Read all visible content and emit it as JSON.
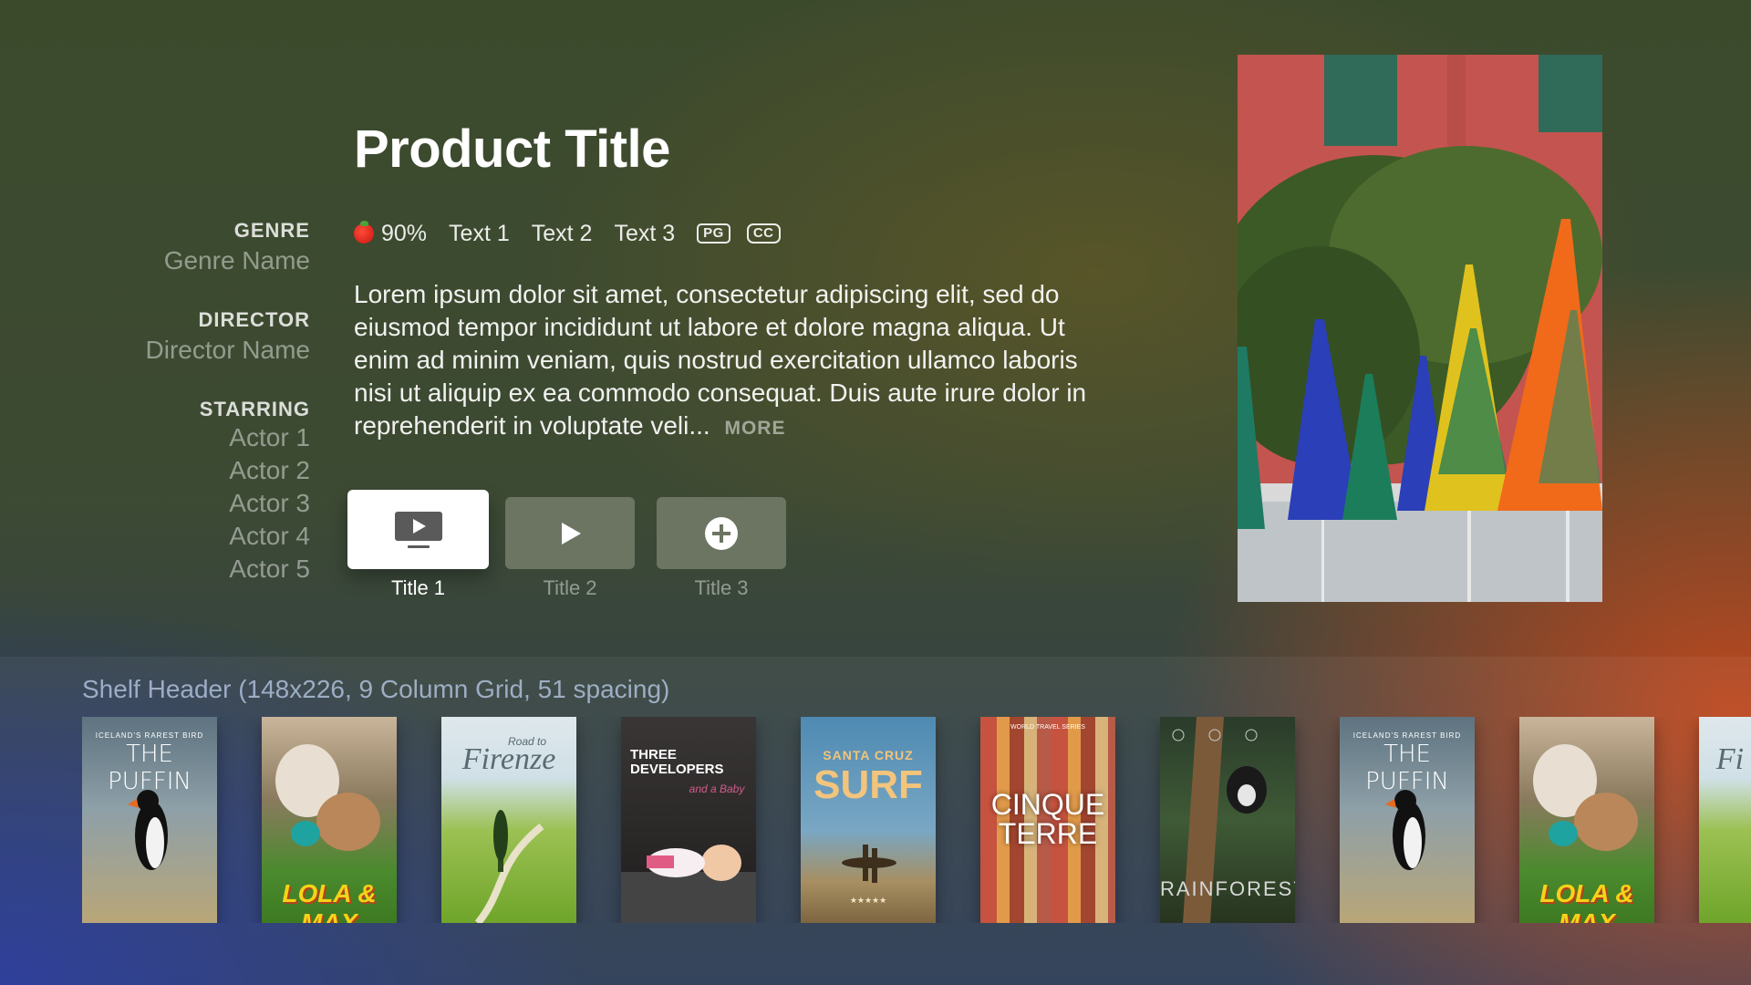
{
  "product": {
    "title": "Product Title",
    "rating_percent": "90%",
    "info_texts": [
      "Text 1",
      "Text 2",
      "Text 3"
    ],
    "badges": [
      "PG",
      "CC"
    ],
    "description": "Lorem ipsum dolor sit amet, consectetur adipiscing elit, sed do eiusmod tempor incididunt ut labore et dolore magna aliqua. Ut enim ad minim veniam, quis nostrud exercitation ullamco laboris nisi ut aliquip ex ea commodo consequat. Duis aute irure dolor in reprehenderit in voluptate veli...",
    "more_label": "MORE"
  },
  "metadata": {
    "genre_label": "GENRE",
    "genre_value": "Genre Name",
    "director_label": "DIRECTOR",
    "director_value": "Director Name",
    "starring_label": "STARRING",
    "actors": [
      "Actor 1",
      "Actor 2",
      "Actor 3",
      "Actor 4",
      "Actor 5"
    ]
  },
  "actions": [
    {
      "label": "Title 1",
      "icon": "tv-play-icon",
      "focused": true
    },
    {
      "label": "Title 2",
      "icon": "play-icon",
      "focused": false
    },
    {
      "label": "Title 3",
      "icon": "plus-circle-icon",
      "focused": false
    }
  ],
  "shelf": {
    "header": "Shelf Header (148x226, 9 Column Grid, 51 spacing)",
    "posters": [
      {
        "name": "puffin",
        "line1": "ICELAND'S RAREST BIRD",
        "line2": "THE PUFFIN"
      },
      {
        "name": "lola-max",
        "line1": "LOLA & MAX"
      },
      {
        "name": "firenze",
        "line1": "Road to",
        "line2": "Firenze"
      },
      {
        "name": "three-developers",
        "line1": "THREE DEVELOPERS",
        "line2": "and a Baby"
      },
      {
        "name": "surf",
        "line1": "SANTA CRUZ",
        "line2": "SURF",
        "line3": "★★★★★"
      },
      {
        "name": "cinque-terre",
        "line1": "WORLD TRAVEL SERIES",
        "line2": "CINQUE TERRE"
      },
      {
        "name": "rainforest",
        "line1": "RAINFOREST"
      },
      {
        "name": "puffin-2",
        "line1": "ICELAND'S RAREST BIRD",
        "line2": "THE PUFFIN"
      },
      {
        "name": "lola-max-2",
        "line1": "LOLA & MAX"
      },
      {
        "name": "firenze-2",
        "line1": "Fi"
      }
    ]
  },
  "colors": {
    "focused_button_bg": "#ffffff",
    "unfocused_button_bg": "#6b7561",
    "accent_orange": "#c4481c",
    "accent_blue": "#24369a"
  }
}
